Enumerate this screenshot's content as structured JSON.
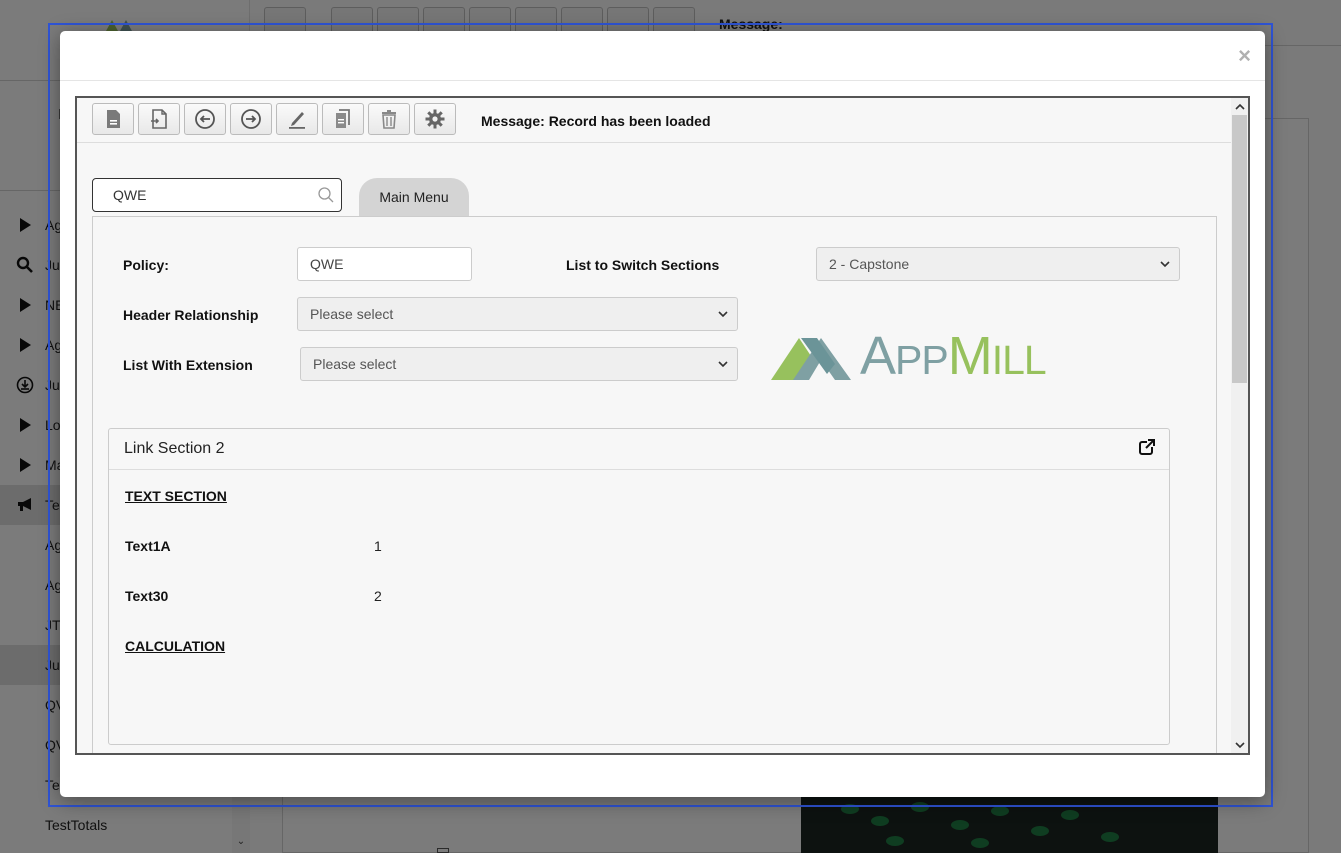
{
  "background": {
    "toolbar_message": "Message:",
    "sidebar_initial": "I",
    "nav_items": [
      {
        "label": "Ag",
        "icon": "triangle-right-icon"
      },
      {
        "label": "Ju",
        "icon": "search-icon"
      },
      {
        "label": "NE",
        "icon": "triangle-right-icon"
      },
      {
        "label": "Ag",
        "icon": "triangle-right-icon"
      },
      {
        "label": "Ju",
        "icon": "download-circle-icon"
      },
      {
        "label": "Lo",
        "icon": "triangle-right-icon"
      },
      {
        "label": "Ma",
        "icon": "triangle-right-icon"
      },
      {
        "label": "Te",
        "icon": "megaphone-icon"
      }
    ],
    "sub_items": [
      "Ag",
      "Ag",
      "JT",
      "Ju",
      "QV",
      "QV",
      "Te",
      "TestTotals"
    ]
  },
  "modal": {
    "close_label": "×",
    "toolbar": {
      "message": "Message: Record has been loaded",
      "buttons": [
        "new-record",
        "open-record",
        "previous",
        "next",
        "edit",
        "copy",
        "delete",
        "settings"
      ]
    },
    "search": {
      "value": "QWE",
      "placeholder": ""
    },
    "tab": {
      "label": "Main Menu"
    },
    "form": {
      "policy_label": "Policy:",
      "policy_value": "QWE",
      "list_switch_label": "List to Switch Sections",
      "list_switch_value": "2 - Capstone",
      "header_rel_label": "Header Relationship",
      "header_rel_value": "Please select",
      "list_ext_label": "List With Extension",
      "list_ext_value": "Please select"
    },
    "logo": {
      "part1": "A",
      "part2": "PP",
      "part3": "M",
      "part4": "ILL"
    },
    "link_section": {
      "title": "Link Section 2",
      "text_heading": "TEXT SECTION",
      "fields": [
        {
          "name": "Text1A",
          "value": "1"
        },
        {
          "name": "Text30",
          "value": "2"
        }
      ],
      "calc_heading": "CALCULATION"
    }
  },
  "colors": {
    "accent": "#2f54d6",
    "logo_teal": "#7fa0a3",
    "logo_green": "#97c15d"
  }
}
